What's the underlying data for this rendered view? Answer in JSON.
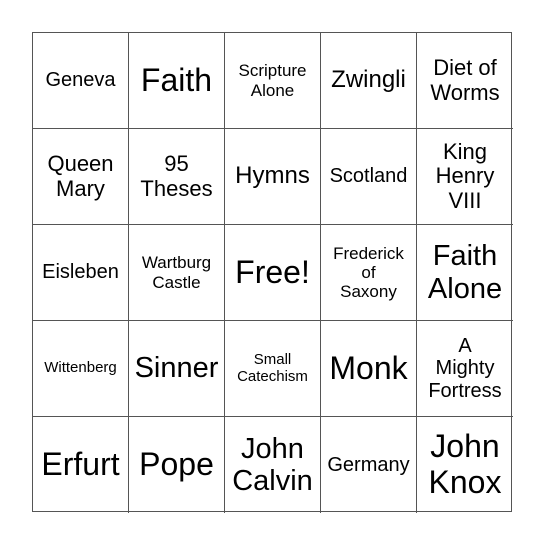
{
  "bingo": {
    "cells": [
      [
        "Geneva",
        "Faith",
        "Scripture\nAlone",
        "Zwingli",
        "Diet of\nWorms"
      ],
      [
        "Queen\nMary",
        "95\nTheses",
        "Hymns",
        "Scotland",
        "King\nHenry\nVIII"
      ],
      [
        "Eisleben",
        "Wartburg\nCastle",
        "Free!",
        "Frederick\nof\nSaxony",
        "Faith\nAlone"
      ],
      [
        "Wittenberg",
        "Sinner",
        "Small\nCatechism",
        "Monk",
        "A\nMighty\nFortress"
      ],
      [
        "Erfurt",
        "Pope",
        "John\nCalvin",
        "Germany",
        "John\nKnox"
      ]
    ],
    "free_space": "Free!"
  }
}
